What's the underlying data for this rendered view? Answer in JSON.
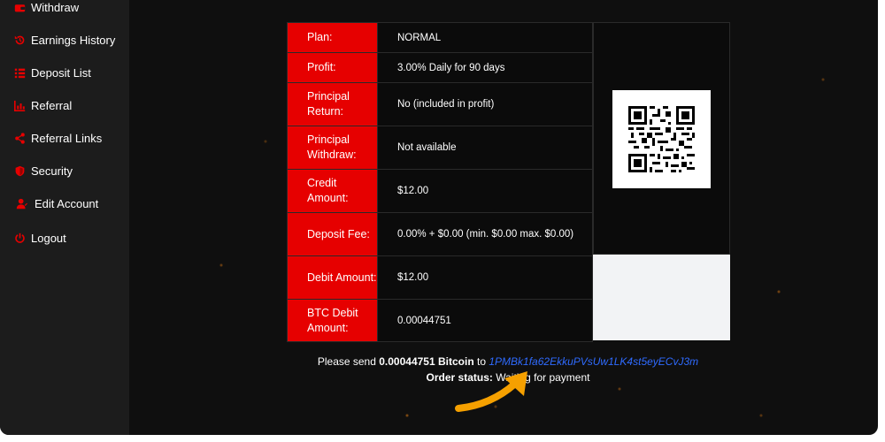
{
  "sidebar": {
    "items": [
      {
        "label": "Withdraw",
        "icon": "wallet-icon"
      },
      {
        "label": "Earnings History",
        "icon": "history-icon"
      },
      {
        "label": "Deposit List",
        "icon": "list-icon"
      },
      {
        "label": "Referral",
        "icon": "bar-chart-icon"
      },
      {
        "label": "Referral Links",
        "icon": "share-icon"
      },
      {
        "label": "Security",
        "icon": "shield-icon"
      },
      {
        "label": "Edit Account",
        "icon": "user-edit-icon"
      },
      {
        "label": "Logout",
        "icon": "power-icon"
      }
    ]
  },
  "deposit": {
    "rows": [
      {
        "label": "Plan:",
        "value": "NORMAL"
      },
      {
        "label": "Profit:",
        "value": "3.00% Daily for 90 days"
      },
      {
        "label": "Principal Return:",
        "value": "No (included in profit)"
      },
      {
        "label": "Principal Withdraw:",
        "value": "Not available"
      },
      {
        "label": "Credit Amount:",
        "value": "$12.00"
      },
      {
        "label": "Deposit Fee:",
        "value": "0.00% + $0.00 (min. $0.00 max. $0.00)"
      },
      {
        "label": "Debit Amount:",
        "value": "$12.00"
      },
      {
        "label": "BTC Debit Amount:",
        "value": "0.00044751"
      }
    ]
  },
  "payment": {
    "send_prefix": "Please send",
    "amount": "0.00044751",
    "currency": "Bitcoin",
    "to": "to",
    "address": "1PMBk1fa62EkkuPVsUw1LK4st5eyECvJ3m",
    "status_label": "Order status:",
    "status_value": "Waiting for payment"
  },
  "colors": {
    "accent_red": "#e60000",
    "address_blue": "#2f6bff",
    "arrow_orange": "#f5a000",
    "background": "#0f0f0f",
    "sidebar_bg": "#1c1c1c"
  }
}
